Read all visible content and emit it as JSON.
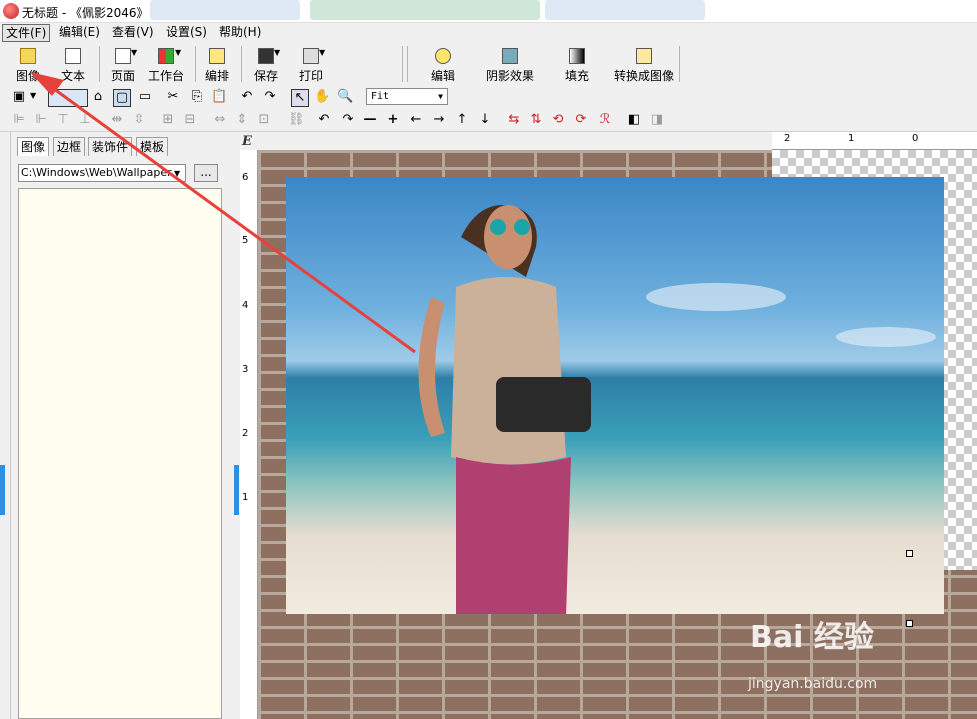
{
  "window": {
    "title": "无标题 - 《佩影2046》"
  },
  "menu": [
    "文件(F)",
    "编辑(E)",
    "查看(V)",
    "设置(S)",
    "帮助(H)"
  ],
  "toolbar": {
    "image": "图像",
    "text": "文本",
    "page": "页面",
    "workbench": "工作台",
    "arrange": "编排",
    "save": "保存",
    "print": "打印",
    "edit": "编辑",
    "shadow": "阴影效果",
    "fill": "填充",
    "convert": "转换成图像"
  },
  "zoom": {
    "value": "Fit"
  },
  "panel": {
    "tabs": [
      "图像",
      "边框",
      "装饰件",
      "模板"
    ],
    "path": "C:\\Windows\\Web\\Wallpaper",
    "browse": "..."
  },
  "rulers": {
    "top": [
      "2",
      "1",
      "0"
    ],
    "left": [
      "6",
      "5",
      "4",
      "3",
      "2",
      "1"
    ],
    "corner": "E"
  },
  "watermark": {
    "main": "Bai 经验",
    "sub": "jingyan.baidu.com"
  },
  "colors": {
    "accent": "#2f8fe0",
    "arrow": "#e8403a"
  }
}
